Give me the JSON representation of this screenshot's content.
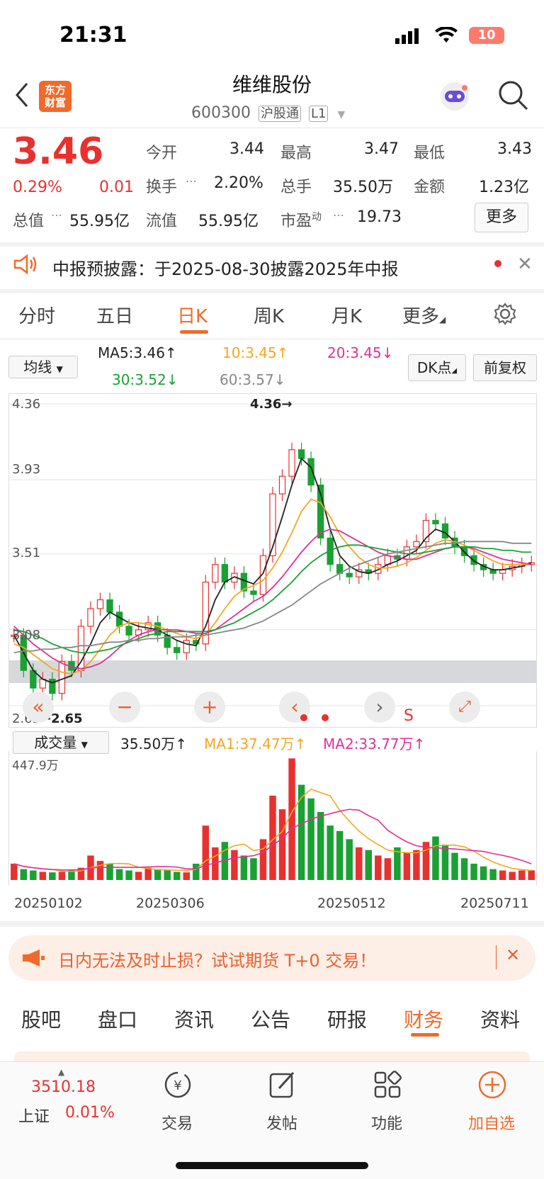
{
  "status_bar": {
    "time": "21:31",
    "battery": "10"
  },
  "header": {
    "logo_text": "东方\n财富",
    "stock_name": "维维股份",
    "stock_code": "600300",
    "tag_connect": "沪股通",
    "tag_level": "L1"
  },
  "quote": {
    "price": "3.46",
    "change_pct": "0.29%",
    "change_abs": "0.01",
    "total_value_label": "总值",
    "total_value": "55.95亿",
    "stats": [
      {
        "label": "今开",
        "value": "3.44",
        "color": "#1aa133"
      },
      {
        "label": "最高",
        "value": "3.47",
        "color": "#e8312f"
      },
      {
        "label": "最低",
        "value": "3.43",
        "color": "#1aa133"
      },
      {
        "label": "换手",
        "value": "2.20%",
        "color": "#222222"
      },
      {
        "label": "总手",
        "value": "35.50万",
        "color": "#222222"
      },
      {
        "label": "金额",
        "value": "1.23亿",
        "color": "#222222"
      },
      {
        "label": "流值",
        "value": "55.95亿",
        "color": "#222222"
      },
      {
        "label": "市盈",
        "sup": "动",
        "value": "19.73",
        "color": "#222222"
      }
    ],
    "more_button": "更多"
  },
  "notice": {
    "text": "中报预披露：于2025-08-30披露2025年中报"
  },
  "chart_tabs": [
    "分时",
    "五日",
    "日K",
    "周K",
    "月K",
    "更多"
  ],
  "active_chart_tab": "日K",
  "ma_bar": {
    "selector": "均线",
    "ma5": "MA5:3.46↑",
    "ma10": "10:3.45↑",
    "ma20": "20:3.45↓",
    "ma30": "30:3.52↓",
    "ma60": "60:3.57↓",
    "dk_button": "DK点",
    "adjust_button": "前复权",
    "colors": {
      "ma5": "#222222",
      "ma10": "#f5a623",
      "ma20": "#e0309a",
      "ma30": "#1aa133",
      "ma60": "#888888"
    }
  },
  "kline": {
    "y_labels": [
      "4.36",
      "3.93",
      "3.51",
      "3.08",
      "2.65"
    ],
    "max_marker": "4.36→",
    "min_marker": "←2.65",
    "s_marker": "S"
  },
  "volume_bar": {
    "selector": "成交量",
    "current": "35.50万↑",
    "ma1": "MA1:37.47万↑",
    "ma2": "MA2:33.77万↑",
    "max_label": "447.9万",
    "dates": [
      "20250102",
      "20250306",
      "20250512",
      "20250711"
    ]
  },
  "chart_data": {
    "type": "line",
    "title": "",
    "x_dates": [
      "20250102",
      "20250306",
      "20250512",
      "20250711"
    ],
    "ylim": [
      2.65,
      4.36
    ],
    "close": [
      3.05,
      2.85,
      2.75,
      2.8,
      2.72,
      2.9,
      2.85,
      3.1,
      3.2,
      3.25,
      3.18,
      3.1,
      3.05,
      3.08,
      3.12,
      3.05,
      2.98,
      2.95,
      3.02,
      3.0,
      3.35,
      3.45,
      3.35,
      3.4,
      3.3,
      3.28,
      3.5,
      3.85,
      3.95,
      4.1,
      4.05,
      3.9,
      3.6,
      3.45,
      3.4,
      3.38,
      3.42,
      3.4,
      3.45,
      3.5,
      3.48,
      3.55,
      3.58,
      3.7,
      3.68,
      3.6,
      3.55,
      3.5,
      3.45,
      3.42,
      3.4,
      3.42,
      3.44,
      3.45,
      3.46
    ],
    "series": [
      {
        "name": "MA5",
        "values": [
          3.05,
          2.95,
          2.85,
          2.8,
          2.78,
          2.8,
          2.82,
          2.9,
          3.0,
          3.12,
          3.18,
          3.15,
          3.12,
          3.1,
          3.09,
          3.08,
          3.05,
          3.02,
          3.0,
          2.99,
          3.1,
          3.25,
          3.35,
          3.38,
          3.36,
          3.34,
          3.4,
          3.55,
          3.72,
          3.9,
          4.05,
          4.0,
          3.85,
          3.65,
          3.5,
          3.44,
          3.41,
          3.4,
          3.42,
          3.45,
          3.47,
          3.5,
          3.53,
          3.6,
          3.65,
          3.63,
          3.58,
          3.52,
          3.47,
          3.44,
          3.42,
          3.42,
          3.43,
          3.44,
          3.46
        ]
      },
      {
        "name": "MA10",
        "values": [
          3.0,
          2.98,
          2.94,
          2.9,
          2.86,
          2.84,
          2.83,
          2.85,
          2.9,
          2.97,
          3.05,
          3.1,
          3.12,
          3.12,
          3.11,
          3.1,
          3.08,
          3.06,
          3.04,
          3.03,
          3.05,
          3.12,
          3.2,
          3.27,
          3.31,
          3.33,
          3.36,
          3.43,
          3.52,
          3.63,
          3.75,
          3.82,
          3.8,
          3.72,
          3.62,
          3.55,
          3.49,
          3.45,
          3.43,
          3.43,
          3.44,
          3.46,
          3.49,
          3.53,
          3.57,
          3.59,
          3.58,
          3.56,
          3.53,
          3.5,
          3.47,
          3.45,
          3.45,
          3.45,
          3.45
        ]
      },
      {
        "name": "MA20",
        "values": [
          3.1,
          3.05,
          3.0,
          2.96,
          2.92,
          2.89,
          2.87,
          2.86,
          2.87,
          2.89,
          2.93,
          2.98,
          3.02,
          3.05,
          3.07,
          3.08,
          3.08,
          3.08,
          3.07,
          3.06,
          3.06,
          3.08,
          3.12,
          3.16,
          3.2,
          3.24,
          3.27,
          3.32,
          3.38,
          3.45,
          3.52,
          3.58,
          3.63,
          3.65,
          3.64,
          3.61,
          3.58,
          3.55,
          3.52,
          3.5,
          3.49,
          3.48,
          3.48,
          3.5,
          3.52,
          3.54,
          3.55,
          3.55,
          3.54,
          3.52,
          3.5,
          3.48,
          3.47,
          3.46,
          3.45
        ]
      },
      {
        "name": "MA30",
        "values": [
          3.08,
          3.07,
          3.05,
          3.03,
          3.0,
          2.98,
          2.96,
          2.95,
          2.95,
          2.96,
          2.97,
          2.99,
          3.01,
          3.03,
          3.05,
          3.06,
          3.07,
          3.07,
          3.07,
          3.07,
          3.07,
          3.08,
          3.1,
          3.12,
          3.15,
          3.18,
          3.21,
          3.25,
          3.3,
          3.35,
          3.41,
          3.46,
          3.5,
          3.53,
          3.55,
          3.56,
          3.56,
          3.55,
          3.54,
          3.53,
          3.52,
          3.51,
          3.51,
          3.52,
          3.53,
          3.54,
          3.55,
          3.55,
          3.55,
          3.54,
          3.54,
          3.53,
          3.53,
          3.52,
          3.52
        ]
      },
      {
        "name": "MA60",
        "values": [
          2.95,
          2.96,
          2.96,
          2.97,
          2.97,
          2.98,
          2.98,
          2.99,
          2.99,
          3.0,
          3.01,
          3.01,
          3.02,
          3.02,
          3.03,
          3.03,
          3.04,
          3.04,
          3.04,
          3.05,
          3.05,
          3.06,
          3.07,
          3.08,
          3.09,
          3.11,
          3.13,
          3.16,
          3.19,
          3.22,
          3.26,
          3.3,
          3.34,
          3.37,
          3.4,
          3.43,
          3.45,
          3.47,
          3.49,
          3.51,
          3.52,
          3.53,
          3.54,
          3.55,
          3.56,
          3.57,
          3.57,
          3.58,
          3.58,
          3.58,
          3.58,
          3.58,
          3.57,
          3.57,
          3.57
        ]
      }
    ],
    "volume_ylim": [
      0,
      447.9
    ],
    "volume": [
      60,
      40,
      35,
      30,
      28,
      30,
      35,
      45,
      90,
      70,
      60,
      40,
      35,
      30,
      45,
      40,
      35,
      30,
      28,
      60,
      200,
      120,
      140,
      110,
      90,
      80,
      150,
      310,
      260,
      447,
      350,
      300,
      250,
      200,
      180,
      150,
      120,
      110,
      90,
      80,
      120,
      100,
      110,
      140,
      160,
      130,
      100,
      80,
      60,
      50,
      40,
      35,
      30,
      35,
      35.5
    ]
  },
  "banner": {
    "text": "日内无法及时止损？试试期货 T+0 交易！"
  },
  "sub_tabs": [
    "股吧",
    "盘口",
    "资讯",
    "公告",
    "研报",
    "财务",
    "资料"
  ],
  "active_sub_tab": "财务",
  "bottom_nav": {
    "index_value": "3510.18",
    "index_name": "上证",
    "index_change": "0.01%",
    "items": [
      "交易",
      "发帖",
      "功能",
      "加自选"
    ]
  }
}
